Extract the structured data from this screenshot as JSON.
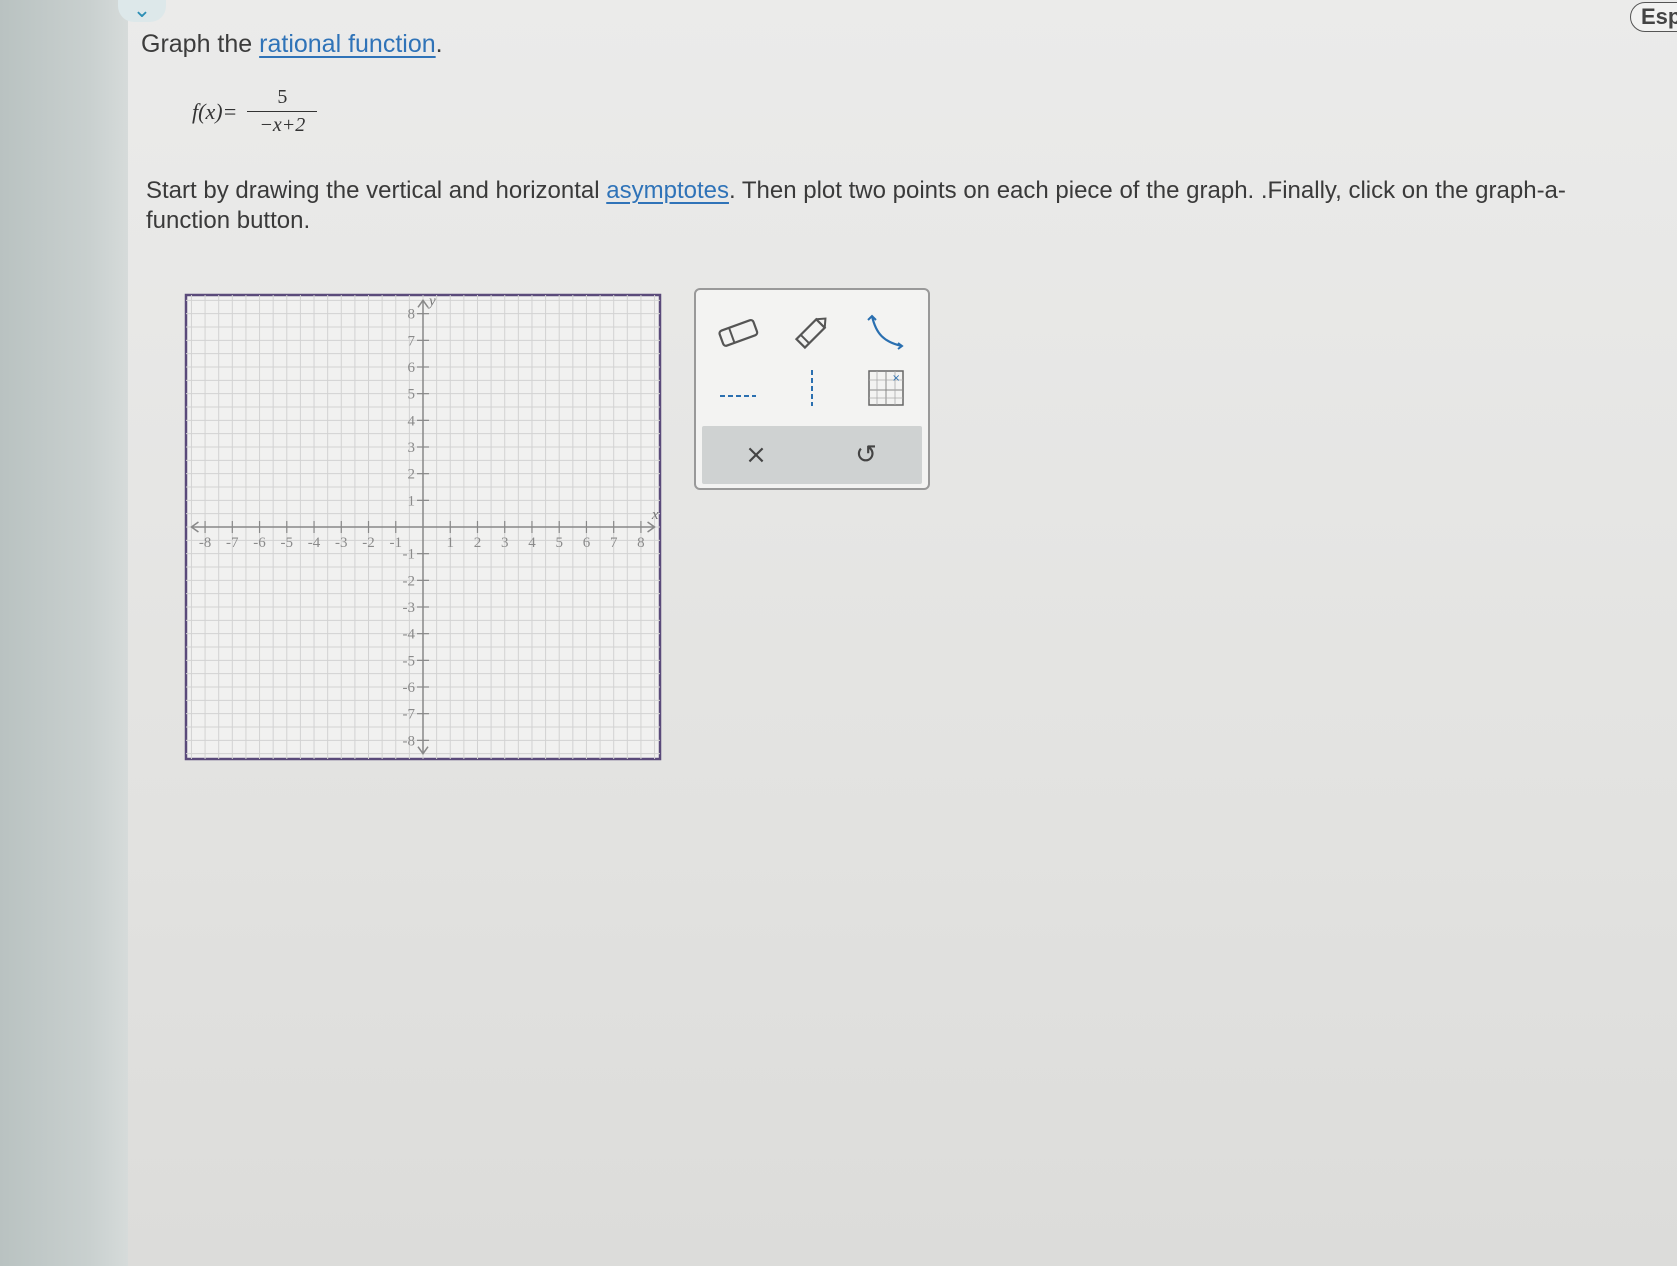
{
  "header": {
    "collapse_glyph": "⌄",
    "language_button": "Esp"
  },
  "problem": {
    "title_prefix": "Graph the ",
    "title_link": "rational function",
    "title_suffix": ".",
    "function_lhs": "f(x)=",
    "numerator": "5",
    "denominator": "−x+2",
    "instr_part1": "Start by drawing the vertical and horizontal ",
    "instr_link": "asymptotes",
    "instr_part2": ". Then plot two points on each piece of the graph. .Finally, click on the graph-a-function button."
  },
  "graph": {
    "x_label": "x",
    "y_label": "y",
    "x_range": [
      -8,
      8
    ],
    "y_range": [
      -8,
      8
    ],
    "grid": true,
    "minor_per_unit": 2,
    "x_ticks": [
      "-8",
      "-7",
      "-6",
      "-5",
      "-4",
      "-3",
      "-2",
      "-1",
      "1",
      "2",
      "3",
      "4",
      "5",
      "6",
      "7",
      "8"
    ],
    "y_ticks": [
      "8",
      "7",
      "6",
      "5",
      "4",
      "3",
      "2",
      "1",
      "-1",
      "-2",
      "-3",
      "-4",
      "-5",
      "-6",
      "-7",
      "-8"
    ]
  },
  "toolbox": {
    "tools": [
      {
        "name": "eraser-icon"
      },
      {
        "name": "pencil-icon"
      },
      {
        "name": "graph-function-icon"
      },
      {
        "name": "horizontal-asymptote-icon"
      },
      {
        "name": "vertical-asymptote-icon"
      },
      {
        "name": "point-tool-icon"
      }
    ],
    "clear_glyph": "×",
    "undo_glyph": "↺"
  }
}
